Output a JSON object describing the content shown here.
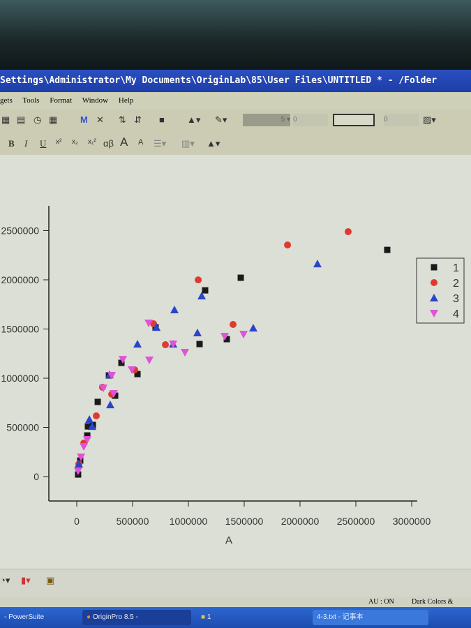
{
  "window": {
    "title": "Settings\\Administrator\\My Documents\\OriginLab\\85\\User Files\\UNTITLED * - /Folder"
  },
  "menu": [
    "gets",
    "Tools",
    "Format",
    "Window",
    "Help"
  ],
  "toolbar": {
    "line_width": "5",
    "spin1": "0",
    "spin2": "0"
  },
  "format_toolbar": [
    "B",
    "I",
    "U",
    "x²",
    "x₂",
    "x₁²",
    "αβ",
    "A",
    "A"
  ],
  "status": {
    "au": "AU : ON",
    "theme": "Dark Colors &"
  },
  "taskbar": [
    "- PowerSuite",
    "OriginPro 8.5 -",
    "1",
    "4-3.txt - 记事本"
  ],
  "chart_data": {
    "type": "scatter",
    "title": "",
    "xlabel": "A",
    "ylabel": "",
    "xlim": [
      -250000,
      3050000
    ],
    "ylim": [
      -250000,
      2750000
    ],
    "x_ticks": [
      "0",
      "500000",
      "1000000",
      "1500000",
      "2000000",
      "2500000",
      "3000000"
    ],
    "x_tick_values": [
      0,
      500000,
      1000000,
      1500000,
      2000000,
      2500000,
      3000000
    ],
    "y_ticks": [
      "0",
      "500000",
      "1000000",
      "1500000",
      "2000000",
      "2500000"
    ],
    "y_tick_values": [
      0,
      500000,
      1000000,
      1500000,
      2000000,
      2500000
    ],
    "legend": "right",
    "grid": false,
    "series": [
      {
        "name": "1",
        "marker": "square",
        "color": "#1a1a1a",
        "x": [
          2781000,
          1469000,
          1150000,
          1344000,
          1100000,
          706000,
          544000,
          400000,
          344000,
          288000,
          188000,
          144000,
          100000,
          94000,
          31000,
          12000
        ],
        "y": [
          2304000,
          2021000,
          1893000,
          1397000,
          1347000,
          1517000,
          1042000,
          1156000,
          822000,
          1028000,
          759000,
          525000,
          510000,
          418000,
          163000,
          21000
        ]
      },
      {
        "name": "2",
        "marker": "circle",
        "color": "#e03a30",
        "x": [
          2431000,
          1888000,
          1088000,
          1400000,
          794000,
          519000,
          688000,
          313000,
          175000,
          231000,
          63000,
          19000
        ],
        "y": [
          2489000,
          2354000,
          1999000,
          1546000,
          1340000,
          1085000,
          1553000,
          837000,
          617000,
          908000,
          340000,
          128000
        ]
      },
      {
        "name": "3",
        "marker": "triangle-up",
        "color": "#2b45c8",
        "x": [
          2156000,
          1119000,
          875000,
          1581000,
          1081000,
          544000,
          713000,
          863000,
          300000,
          113000,
          294000,
          138000,
          19000
        ],
        "y": [
          2162000,
          1836000,
          1695000,
          1510000,
          1461000,
          1347000,
          1517000,
          1347000,
          730000,
          581000,
          1035000,
          510000,
          128000
        ]
      },
      {
        "name": "4",
        "marker": "triangle-down",
        "color": "#e052d8",
        "x": [
          644000,
          1325000,
          1494000,
          650000,
          969000,
          863000,
          413000,
          494000,
          331000,
          238000,
          313000,
          94000,
          63000,
          38000,
          12000
        ],
        "y": [
          1560000,
          1425000,
          1446000,
          1184000,
          1262000,
          1347000,
          1191000,
          1085000,
          844000,
          900000,
          1028000,
          376000,
          305000,
          199000,
          57000
        ]
      }
    ]
  }
}
